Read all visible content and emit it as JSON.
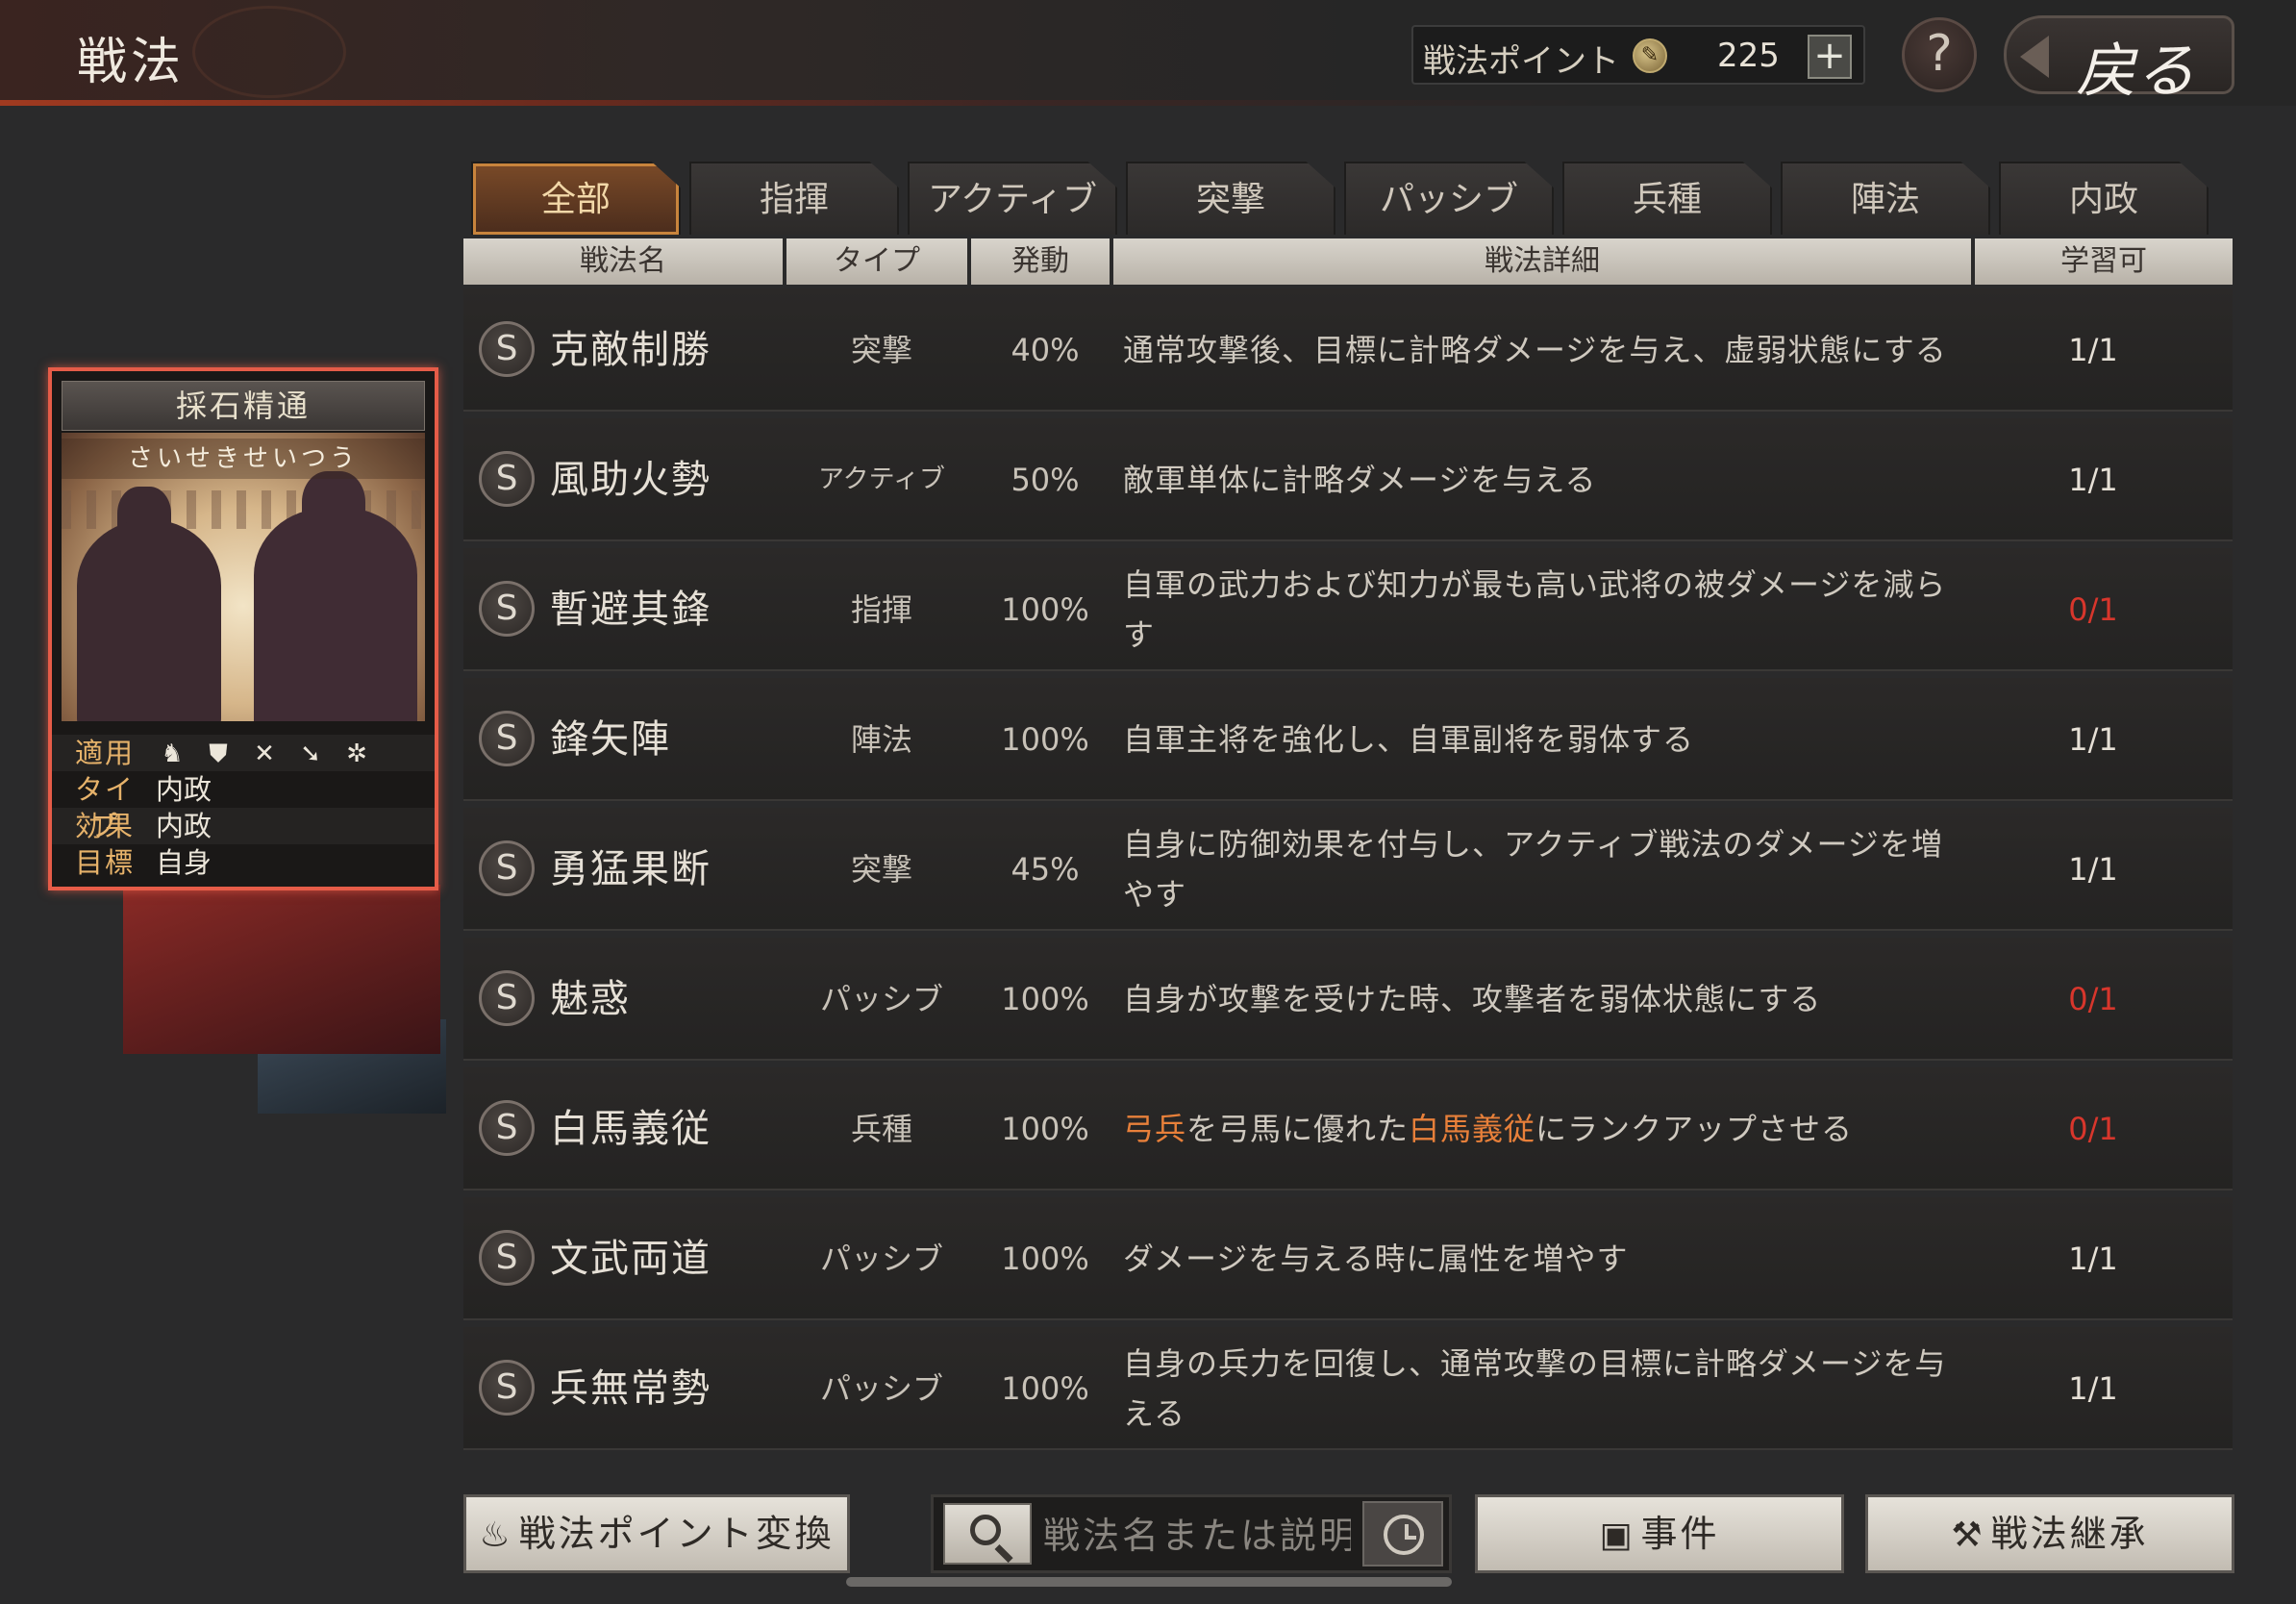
{
  "header": {
    "title": "戦法",
    "points_label": "戦法ポイント",
    "points_value": "225",
    "plus_label": "+",
    "help_label": "?",
    "back_label": "戻る"
  },
  "tabs": [
    {
      "label": "全部",
      "active": true
    },
    {
      "label": "指揮",
      "active": false
    },
    {
      "label": "アクティブ",
      "active": false
    },
    {
      "label": "突撃",
      "active": false
    },
    {
      "label": "パッシブ",
      "active": false
    },
    {
      "label": "兵種",
      "active": false
    },
    {
      "label": "陣法",
      "active": false
    },
    {
      "label": "内政",
      "active": false
    }
  ],
  "columns": {
    "name": "戦法名",
    "type": "タイプ",
    "rate": "発動",
    "detail": "戦法詳細",
    "learnable": "学習可"
  },
  "rows": [
    {
      "grade": "S",
      "name": "克敵制勝",
      "type": "突撃",
      "rate": "40%",
      "desc": "通常攻撃後、目標に計略ダメージを与え、虚弱状態にする",
      "learn": "1/1"
    },
    {
      "grade": "S",
      "name": "風助火勢",
      "type": "アクティブ",
      "rate": "50%",
      "desc": "敵軍単体に計略ダメージを与える",
      "learn": "1/1"
    },
    {
      "grade": "S",
      "name": "暫避其鋒",
      "type": "指揮",
      "rate": "100%",
      "desc": "自軍の武力および知力が最も高い武将の被ダメージを減らす",
      "learn": "0/1"
    },
    {
      "grade": "S",
      "name": "鋒矢陣",
      "type": "陣法",
      "rate": "100%",
      "desc": "自軍主将を強化し、自軍副将を弱体する",
      "learn": "1/1"
    },
    {
      "grade": "S",
      "name": "勇猛果断",
      "type": "突撃",
      "rate": "45%",
      "desc": "自身に防御効果を付与し、アクティブ戦法のダメージを増やす",
      "learn": "1/1"
    },
    {
      "grade": "S",
      "name": "魅惑",
      "type": "パッシブ",
      "rate": "100%",
      "desc": "自身が攻撃を受けた時、攻撃者を弱体状態にする",
      "learn": "0/1"
    },
    {
      "grade": "S",
      "name": "白馬義従",
      "type": "兵種",
      "rate": "100%",
      "desc_parts": [
        "弓兵",
        "を弓馬に優れた",
        "白馬義従",
        "にランクアップさせる"
      ],
      "learn": "0/1"
    },
    {
      "grade": "S",
      "name": "文武両道",
      "type": "パッシブ",
      "rate": "100%",
      "desc": "ダメージを与える時に属性を増やす",
      "learn": "1/1"
    },
    {
      "grade": "S",
      "name": "兵無常勢",
      "type": "パッシブ",
      "rate": "100%",
      "desc": "自身の兵力を回復し、通常攻撃の目標に計略ダメージを与える",
      "learn": "1/1"
    }
  ],
  "card": {
    "title": "採石精通",
    "reading": "さいせきせいつう",
    "apply_label": "適用",
    "apply_icons": [
      "cavalry-icon",
      "shield-icon",
      "bow-icon",
      "spear-icon",
      "wheel-icon"
    ],
    "type_label": "タイプ",
    "type_value": "内政",
    "effect_label": "効果",
    "effect_value": "内政",
    "target_label": "目標",
    "target_value": "自身"
  },
  "bottom": {
    "convert_label": "戦法ポイント変換",
    "search_placeholder": "戦法名または説明",
    "events_label": "事件",
    "inherit_label": "戦法継承"
  },
  "colors": {
    "accent_orange": "#e8803a",
    "unavailable_red": "#d8362c",
    "card_border": "#e65c48"
  }
}
